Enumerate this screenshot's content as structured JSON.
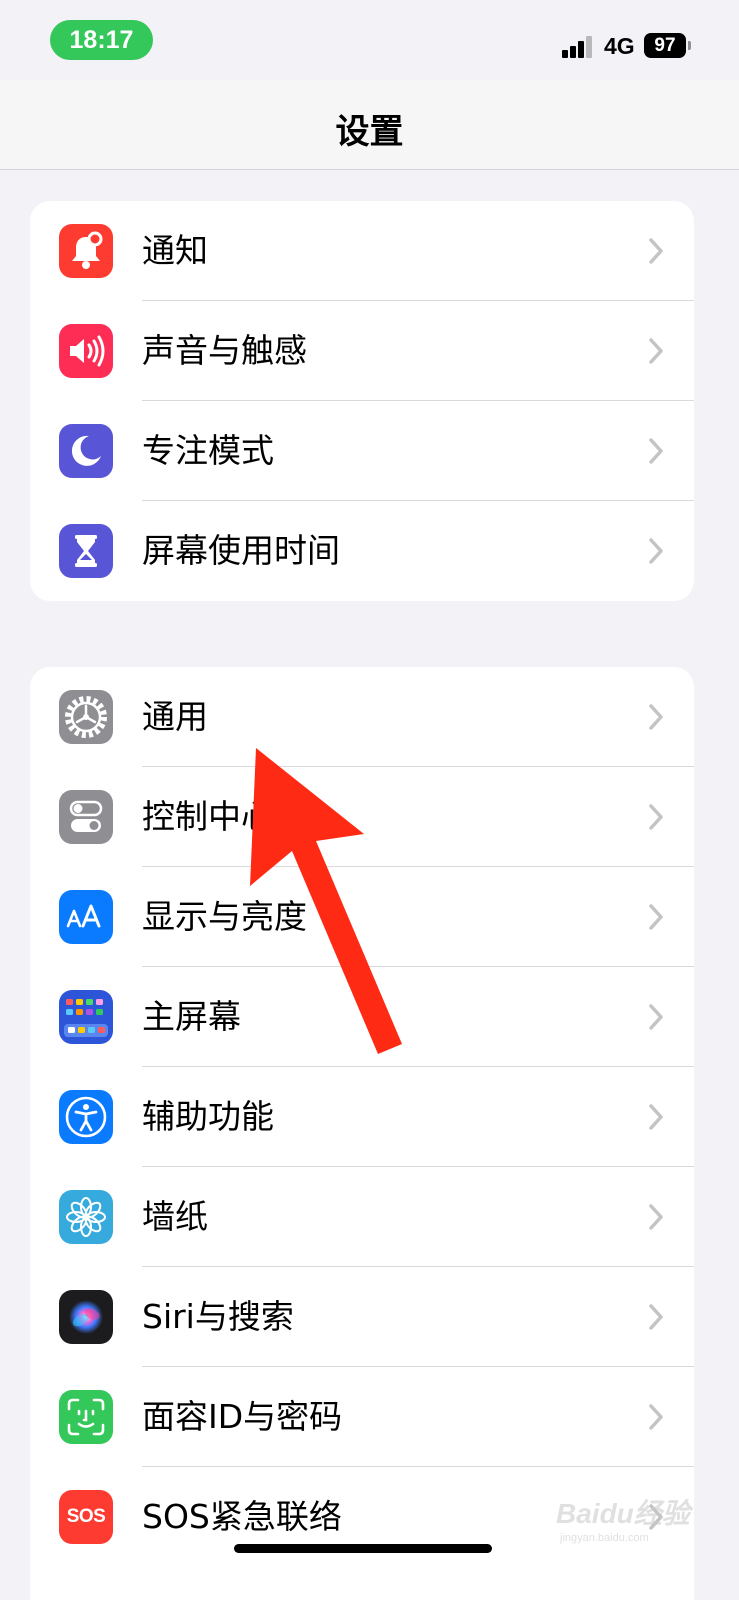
{
  "status_bar": {
    "time": "18:17",
    "network": "4G",
    "battery": "97"
  },
  "nav": {
    "title": "设置"
  },
  "group1": [
    {
      "label": "通知",
      "icon": "bell-icon",
      "color": "#fe3b30"
    },
    {
      "label": "声音与触感",
      "icon": "speaker-icon",
      "color": "#fe2d55"
    },
    {
      "label": "专注模式",
      "icon": "moon-icon",
      "color": "#5856d6"
    },
    {
      "label": "屏幕使用时间",
      "icon": "hourglass-icon",
      "color": "#5856d6"
    }
  ],
  "group2": [
    {
      "label": "通用",
      "icon": "gear-icon",
      "color": "#8e8e93"
    },
    {
      "label": "控制中心",
      "icon": "toggles-icon",
      "color": "#8e8e93"
    },
    {
      "label": "显示与亮度",
      "icon": "text-size-icon",
      "color": "#0a7aff"
    },
    {
      "label": "主屏幕",
      "icon": "home-grid-icon",
      "color": "#2c55d8"
    },
    {
      "label": "辅助功能",
      "icon": "accessibility-icon",
      "color": "#0a7aff"
    },
    {
      "label": "墙纸",
      "icon": "flower-icon",
      "color": "#36aadc"
    },
    {
      "label": "Siri与搜索",
      "icon": "siri-icon",
      "color": "#1c1c1e"
    },
    {
      "label": "面容ID与密码",
      "icon": "face-id-icon",
      "color": "#34c759"
    },
    {
      "label": "SOS紧急联络",
      "icon": "sos-icon",
      "color": "#fe3b30",
      "icon_text": "SOS"
    }
  ],
  "annotation": {
    "color": "#ff2a14"
  },
  "watermark": {
    "text": "Baidu经验",
    "subtext": "jingyan.baidu.com"
  }
}
